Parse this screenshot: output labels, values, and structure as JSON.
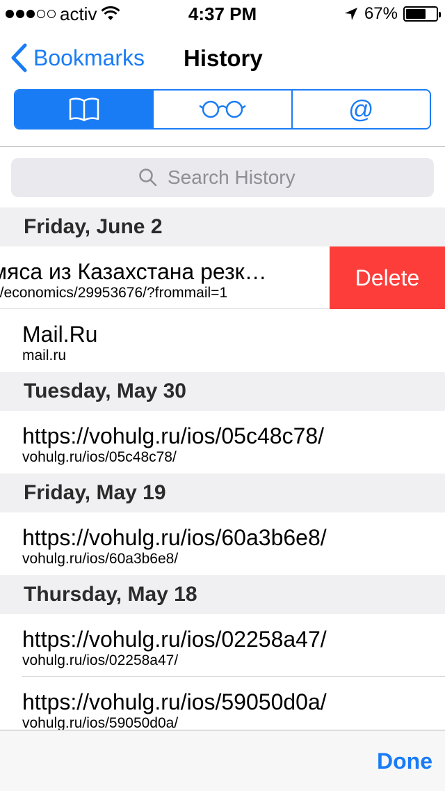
{
  "status_bar": {
    "signal_filled": 3,
    "signal_total": 5,
    "carrier": "activ",
    "time": "4:37 PM",
    "battery_percent": "67%",
    "battery_level": 0.67
  },
  "nav": {
    "back_label": "Bookmarks",
    "title": "History"
  },
  "segments": [
    {
      "icon": "book-icon",
      "active": true
    },
    {
      "icon": "reading-glasses-icon",
      "active": false
    },
    {
      "icon": "at-sign-icon",
      "label": "@",
      "active": false
    }
  ],
  "search": {
    "placeholder": "Search History"
  },
  "history": {
    "sections": [
      {
        "date": "Friday, June 2",
        "items": [
          {
            "title": "мяса из Казахстана резк…",
            "url": "u/economics/29953676/?frommail=1",
            "delete_label": "Delete"
          },
          {
            "title": "Mail.Ru",
            "url": "mail.ru"
          }
        ]
      },
      {
        "date": "Tuesday, May 30",
        "items": [
          {
            "title": "https://vohulg.ru/ios/05c48c78/",
            "url": "vohulg.ru/ios/05c48c78/"
          }
        ]
      },
      {
        "date": "Friday, May 19",
        "items": [
          {
            "title": "https://vohulg.ru/ios/60a3b6e8/",
            "url": "vohulg.ru/ios/60a3b6e8/"
          }
        ]
      },
      {
        "date": "Thursday, May 18",
        "items": [
          {
            "title": "https://vohulg.ru/ios/02258a47/",
            "url": "vohulg.ru/ios/02258a47/"
          },
          {
            "title": "https://vohulg.ru/ios/59050d0a/",
            "url": "vohulg.ru/ios/59050d0a/"
          }
        ]
      }
    ]
  },
  "toolbar": {
    "done_label": "Done"
  },
  "colors": {
    "accent": "#1a7cf5",
    "delete": "#fc3d39",
    "section_bg": "#f0f0f2"
  }
}
